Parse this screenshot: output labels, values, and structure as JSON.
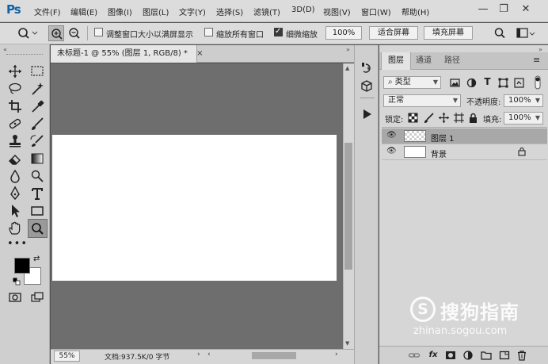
{
  "app": {
    "logo": "Ps"
  },
  "menu": [
    "文件(F)",
    "编辑(E)",
    "图像(I)",
    "图层(L)",
    "文字(Y)",
    "选择(S)",
    "滤镜(T)",
    "3D(D)",
    "视图(V)",
    "窗口(W)",
    "帮助(H)"
  ],
  "window_controls": {
    "minimize": "—",
    "restore": "❐",
    "close": "✕"
  },
  "options": {
    "tool_icon": "zoom-icon",
    "resize_windows_label": "调整窗口大小以满屏显示",
    "resize_windows_checked": false,
    "zoom_all_label": "缩放所有窗口",
    "zoom_all_checked": false,
    "scrubby_zoom_label": "细微缩放",
    "scrubby_zoom_checked": true,
    "zoom_percent": "100%",
    "fit_screen_label": "适合屏幕",
    "fill_screen_label": "填充屏幕"
  },
  "document": {
    "tab_title": "未标题-1 @ 55% (图层 1, RGB/8) *",
    "tab_close": "×",
    "zoom": "55%",
    "info": "文档:937.5K/0 字节"
  },
  "panel": {
    "tabs": [
      "图层",
      "通道",
      "路径"
    ],
    "filter_kind": "类型",
    "blend_mode": "正常",
    "opacity_label": "不透明度:",
    "opacity_value": "100%",
    "lock_label": "锁定:",
    "fill_label": "填充:",
    "fill_value": "100%",
    "layers": [
      {
        "name": "图层 1",
        "selected": true,
        "locked": false
      },
      {
        "name": "背景",
        "selected": false,
        "locked": true
      }
    ],
    "footer_icons": [
      "link-icon",
      "fx-icon",
      "mask-icon",
      "adjustment-icon",
      "group-icon",
      "new-layer-icon",
      "trash-icon"
    ]
  },
  "watermark": {
    "logo_letter": "S",
    "name": "搜狗指南",
    "url": "zhinan.sogou.com"
  },
  "colors": {
    "foreground": "#000000",
    "background": "#ffffff",
    "menu_bg": "#dcdcdc",
    "panel_bg": "#d6d6d6",
    "canvas_bg": "#6e6e6e"
  }
}
